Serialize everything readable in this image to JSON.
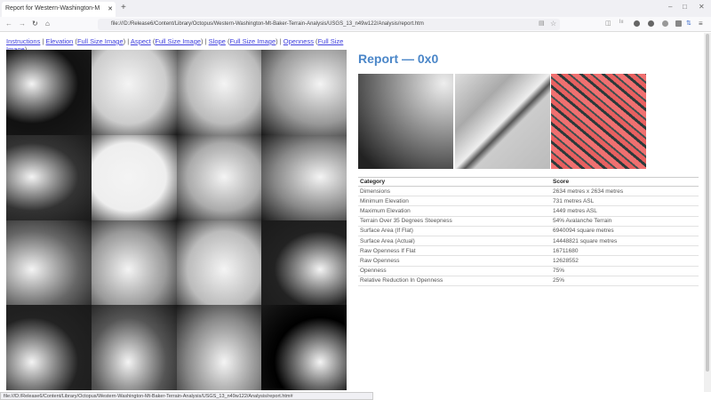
{
  "browser": {
    "tab_title": "Report for Western-Washington-M",
    "url": "file:///D:/Release6/Content/Library/Octopus/Western-Washington-Mt-Baker-Terrain-Analysis/USGS_13_n49w122/Analysis/report.htm",
    "status_url": "file:///D:/Release6/Content/Library/Octopus/Western-Washington-Mt-Baker-Terrain-Analysis/USGS_13_n49w122/Analysis/report.htm#"
  },
  "links": {
    "instructions": "Instructions",
    "elevation": "Elevation",
    "aspect": "Aspect",
    "slope": "Slope",
    "openness": "Openness",
    "full": "Full Size Image"
  },
  "report": {
    "title": "Report — 0x0"
  },
  "table": {
    "headers": [
      "Category",
      "Score"
    ],
    "rows": [
      [
        "Dimensions",
        "2634 metres x 2634 metres"
      ],
      [
        "Minimum Elevation",
        "731 metres ASL"
      ],
      [
        "Maximum Elevation",
        "1449 metres ASL"
      ],
      [
        "Terrain Over 35 Degrees Steepness",
        "54% Avalanche Terrain"
      ],
      [
        "Surface Area (If Flat)",
        "6940094 square metres"
      ],
      [
        "Surface Area (Actual)",
        "14448821 square metres"
      ],
      [
        "Raw Openness If Flat",
        "16711680"
      ],
      [
        "Raw Openness",
        "12628552"
      ],
      [
        "Openness",
        "75%"
      ],
      [
        "Relative Reduction In Openness",
        "25%"
      ]
    ]
  }
}
